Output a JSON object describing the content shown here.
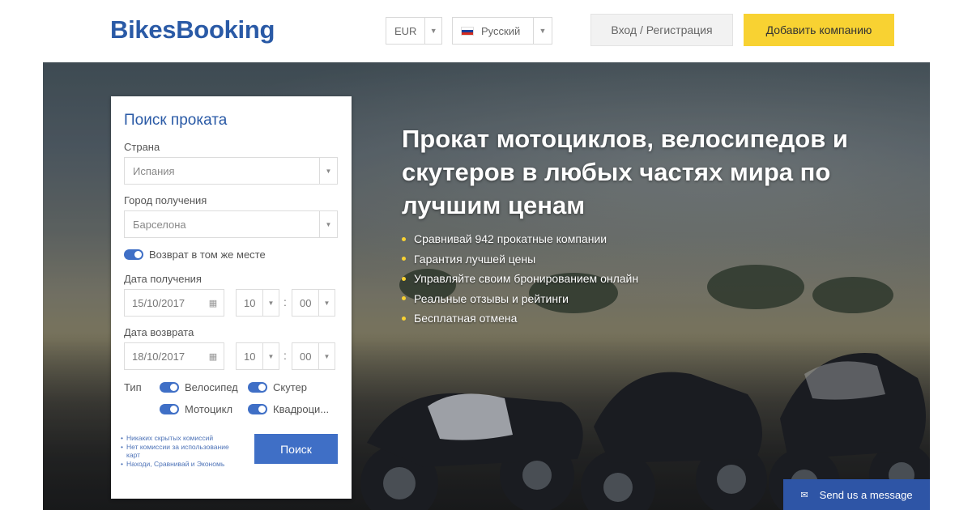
{
  "header": {
    "logo": "BikesBooking",
    "currency": "EUR",
    "language": "Русский",
    "login_label": "Вход / Регистрация",
    "add_company_label": "Добавить компанию"
  },
  "hero": {
    "title": "Прокат мотоциклов, велосипедов и скутеров в любых частях мира по лучшим ценам",
    "features": [
      "Сравнивай 942 прокатные компании",
      "Гарантия лучшей цены",
      "Управляйте своим бронированием онлайн",
      "Реальные отзывы и рейтинги",
      "Бесплатная отмена"
    ]
  },
  "search": {
    "title": "Поиск проката",
    "country_label": "Страна",
    "country_value": "Испания",
    "city_label": "Город получения",
    "city_value": "Барселона",
    "same_place_label": "Возврат в том же месте",
    "pickup_date_label": "Дата получения",
    "pickup_date": "15/10/2017",
    "pickup_hour": "10",
    "pickup_min": "00",
    "return_date_label": "Дата возврата",
    "return_date": "18/10/2017",
    "return_hour": "10",
    "return_min": "00",
    "type_label": "Тип",
    "types": [
      "Велосипед",
      "Скутер",
      "Мотоцикл",
      "Квадроци..."
    ],
    "notes": [
      "Никаких скрытых комиссий",
      "Нет комиссии за использование карт",
      "Находи, Сравнивай и Экономь"
    ],
    "search_label": "Поиск"
  },
  "chat": {
    "label": "Send us a message",
    "icon": "envelope-icon"
  },
  "colors": {
    "brand_blue": "#2a5aa6",
    "accent_yellow": "#f8d232",
    "button_blue": "#3f6fc6"
  }
}
